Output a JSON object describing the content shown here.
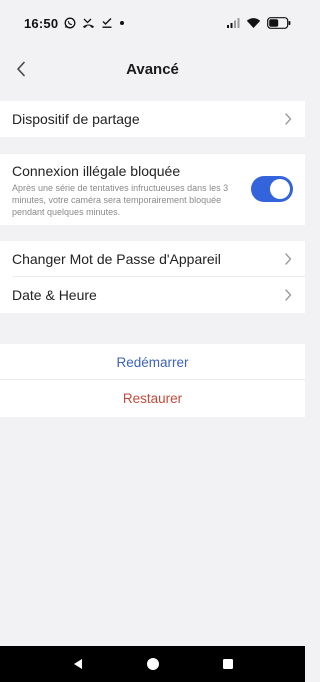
{
  "status_bar": {
    "time": "16:50",
    "left_icons": [
      "whatsapp-icon",
      "missed-call-icon",
      "download-check-icon",
      "dot-icon"
    ],
    "right_icons": [
      "signal-icon",
      "wifi-icon",
      "battery-icon"
    ]
  },
  "header": {
    "title": "Avancé",
    "back_icon": "chevron-left-icon"
  },
  "sections": {
    "share": {
      "label": "Dispositif de partage"
    },
    "illegal_login": {
      "label": "Connexion illégale bloquée",
      "description": "Après une série de tentatives infructueuses dans les 3 minutes, votre caméra sera temporairement bloquée pendant quelques minutes.",
      "enabled": true
    },
    "device_password": {
      "label": "Changer Mot de Passe d'Appareil"
    },
    "date_time": {
      "label": "Date & Heure"
    }
  },
  "actions": {
    "reboot_label": "Redémarrer",
    "restore_label": "Restaurer"
  },
  "colors": {
    "accent": "#3464db",
    "reboot": "#3e63b8",
    "restore": "#c24b3b",
    "background": "#f2f2f4"
  },
  "nav_bar": {
    "icons": [
      "back-triangle-icon",
      "home-circle-icon",
      "recents-square-icon"
    ]
  }
}
